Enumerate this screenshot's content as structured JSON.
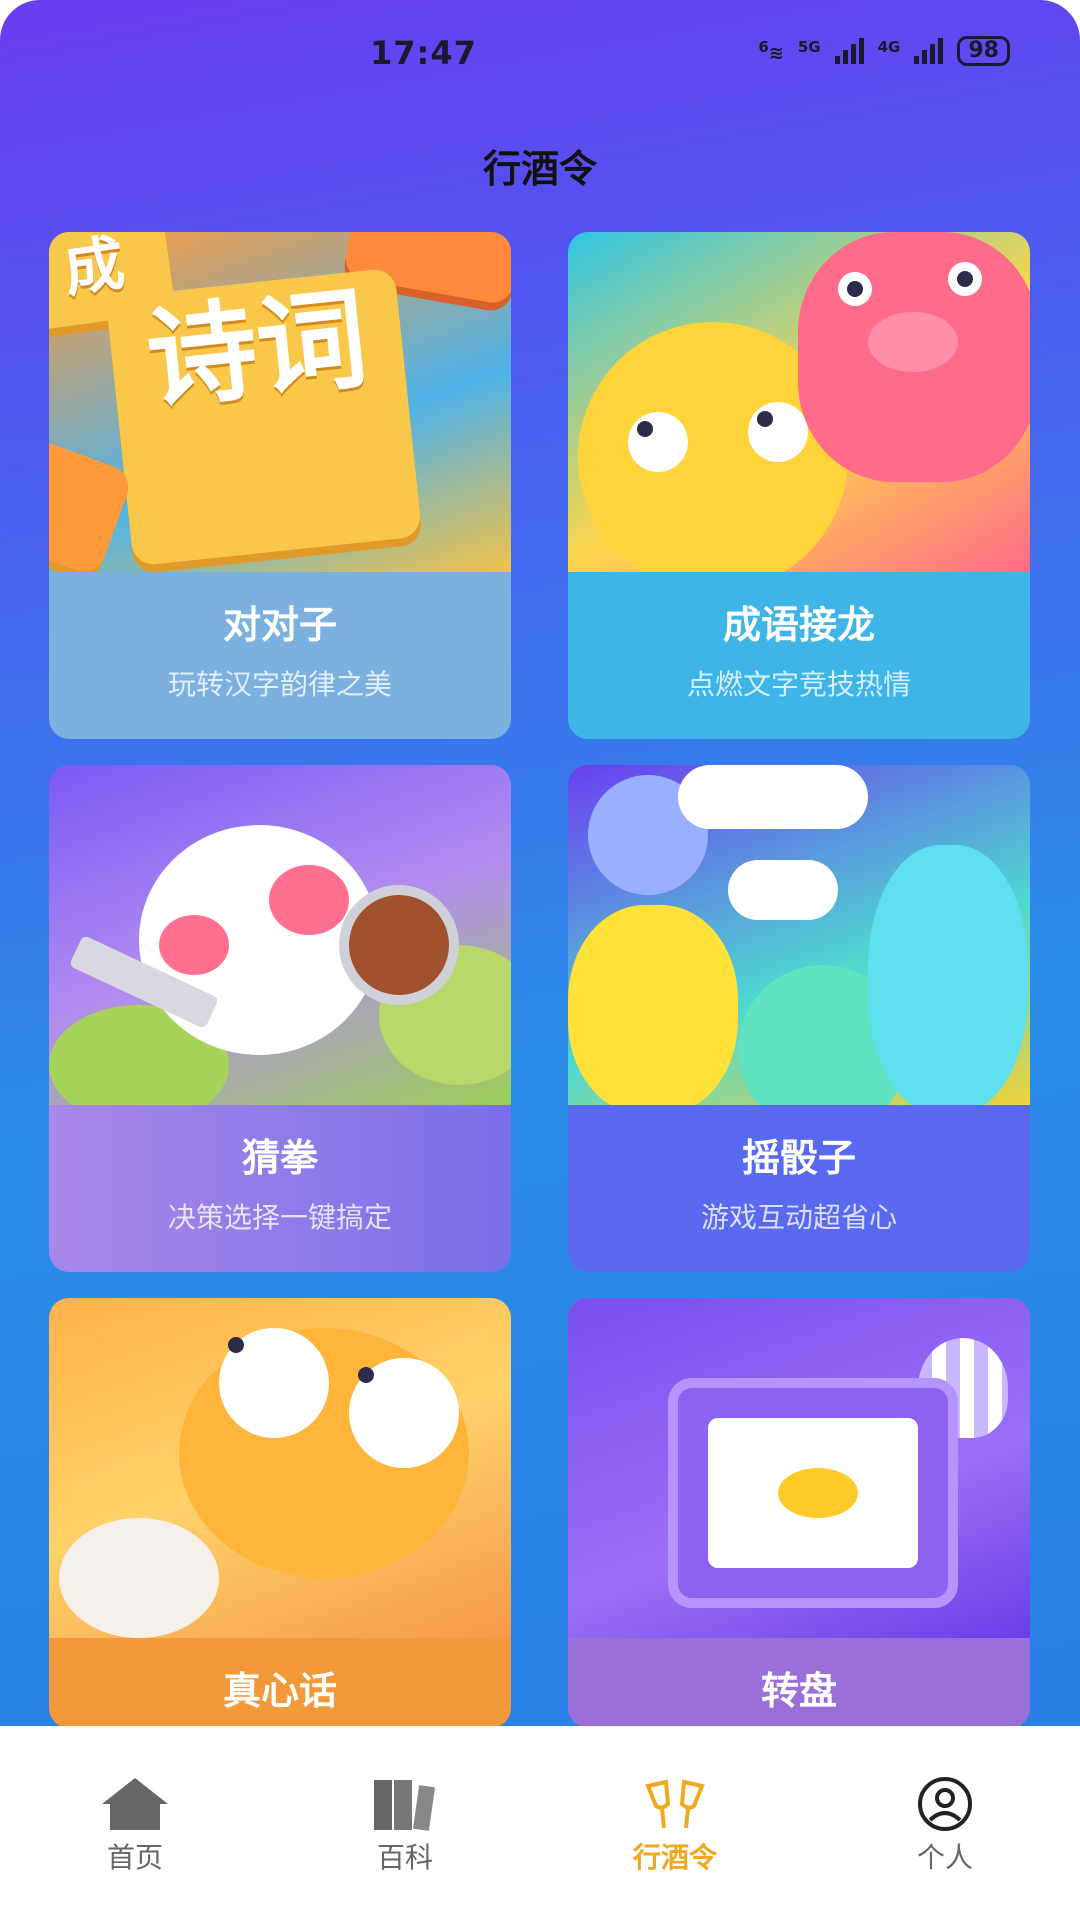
{
  "status_bar": {
    "time": "17:47",
    "net1": "6",
    "net2": "5G",
    "net3": "4G",
    "battery": "98"
  },
  "header": {
    "title": "行酒令"
  },
  "cards": [
    {
      "name": "对对子",
      "desc": "玩转汉字韵律之美",
      "art_text": "诗词",
      "art_text2": "成"
    },
    {
      "name": "成语接龙",
      "desc": "点燃文字竞技热情"
    },
    {
      "name": "猜拳",
      "desc": "决策选择一键搞定"
    },
    {
      "name": "摇骰子",
      "desc": "游戏互动超省心"
    },
    {
      "name": "真心话",
      "desc": ""
    },
    {
      "name": "转盘",
      "desc": ""
    }
  ],
  "tabbar": {
    "items": [
      {
        "label": "首页",
        "icon": "home-icon"
      },
      {
        "label": "百科",
        "icon": "books-icon"
      },
      {
        "label": "行酒令",
        "icon": "cheers-icon",
        "active": true
      },
      {
        "label": "个人",
        "icon": "user-icon"
      }
    ]
  },
  "colors": {
    "accent": "#f2a81e",
    "tab_inactive": "#666666"
  }
}
